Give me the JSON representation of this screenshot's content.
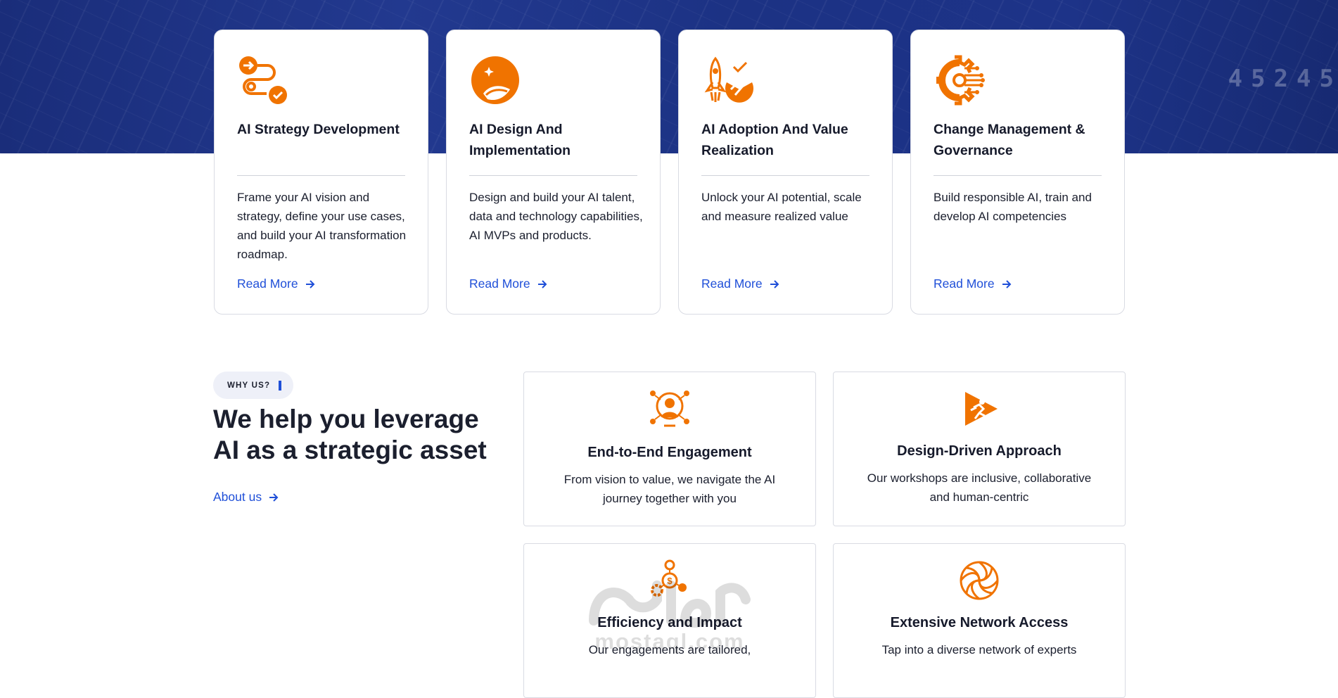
{
  "hero": {
    "background_numbers": "45245"
  },
  "services": [
    {
      "icon": "strategy-path-icon",
      "title": "AI Strategy Development",
      "description": "Frame your AI vision and strategy, define your use cases, and build your AI transformation roadmap.",
      "link": "Read More"
    },
    {
      "icon": "design-bowl-icon",
      "title": "AI Design And Implementation",
      "description": "Design and build your AI talent, data and technology capabilities, AI MVPs and products.",
      "link": "Read More"
    },
    {
      "icon": "rocket-growth-icon",
      "title": "AI Adoption And Value Realization",
      "description": "Unlock your AI potential, scale and measure realized value",
      "link": "Read More"
    },
    {
      "icon": "gear-circuit-icon",
      "title": "Change Management & Governance",
      "description": "Build responsible AI, train and develop AI competencies",
      "link": "Read More"
    }
  ],
  "why": {
    "badge": "WHY US?",
    "heading": "We help you leverage AI as a strategic asset",
    "link": "About us"
  },
  "features": [
    {
      "icon": "network-person-icon",
      "title": "End-to-End Engagement",
      "description": "From vision to value, we navigate the AI journey together with you"
    },
    {
      "icon": "runner-triangle-icon",
      "title": "Design-Driven Approach",
      "description": "Our workshops are inclusive, collaborative and human-centric"
    },
    {
      "icon": "gears-money-icon",
      "title": "Efficiency and Impact",
      "description": "Our engagements are tailored,"
    },
    {
      "icon": "spiral-icon",
      "title": "Extensive Network Access",
      "description": "Tap into a diverse network of experts"
    }
  ],
  "watermark": {
    "text": "mostaql.com"
  },
  "colors": {
    "accent": "#f07300",
    "link": "#1f4fd8",
    "hero": "#1d3388"
  }
}
